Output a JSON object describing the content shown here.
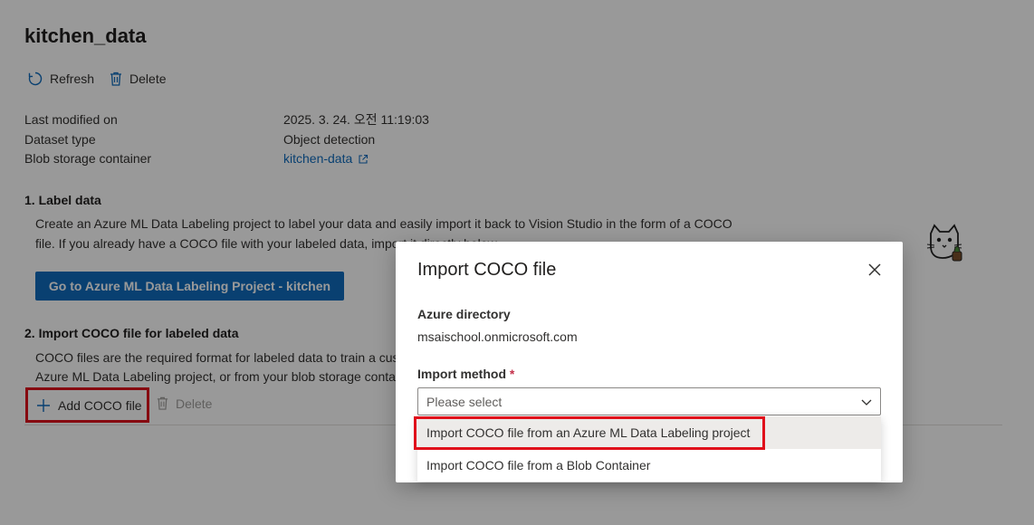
{
  "page": {
    "title": "kitchen_data",
    "toolbar": {
      "refresh_label": "Refresh",
      "delete_label": "Delete"
    },
    "properties": [
      {
        "key": "Last modified on",
        "value": "2025. 3. 24. 오전 11:19:03"
      },
      {
        "key": "Dataset type",
        "value": "Object detection"
      },
      {
        "key": "Blob storage container",
        "value": "kitchen-data"
      }
    ],
    "section1": {
      "title": "1. Label data",
      "line1": "Create an Azure ML Data Labeling project to label your data and easily import it back to Vision Studio in the form of a COCO",
      "line2": "file. If you already have a COCO file with your labeled data, import it directly below.",
      "button_label": "Go to Azure ML Data Labeling Project - kitchen"
    },
    "section2": {
      "title": "2. Import COCO file for labeled data",
      "line1": "COCO files are the required format for labeled data to train a custom model. You can import COCO files from an",
      "line2": "Azure ML Data Labeling project, or from your blob storage container.",
      "add_label": "Add COCO file",
      "delete_label": "Delete"
    }
  },
  "dialog": {
    "title": "Import COCO file",
    "directory_label": "Azure directory",
    "directory_value": "msaischool.onmicrosoft.com",
    "method_label": "Import method",
    "required_mark": "*",
    "select_placeholder": "Please select",
    "options": [
      "Import COCO file from an Azure ML Data Labeling project",
      "Import COCO file from a Blob Container"
    ]
  },
  "colors": {
    "accent": "#0f6cbd",
    "highlight": "#e0101b",
    "overlay": "rgba(0,0,0,0.4)"
  }
}
